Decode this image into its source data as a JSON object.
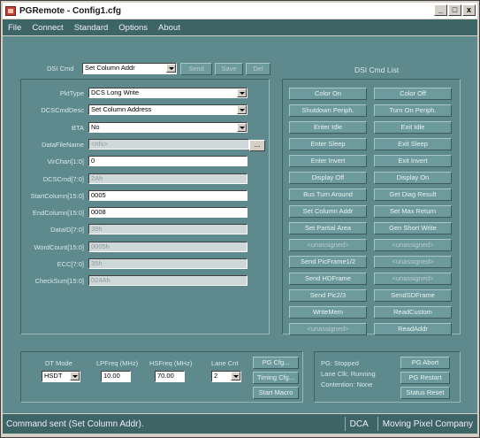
{
  "window": {
    "title": "PGRemote - Config1.cfg",
    "minimize": "_",
    "maximize": "□",
    "close": "x"
  },
  "menu": [
    "File",
    "Connect",
    "Standard",
    "Options",
    "About"
  ],
  "dsi_cmd": {
    "label": "DSI Cmd",
    "value": "Set Column Addr",
    "send": "Send",
    "save": "Save",
    "del": "Del"
  },
  "params": [
    {
      "label": "PktType",
      "value": "DCS Long Write",
      "kind": "dropdown"
    },
    {
      "label": "DCSCmdDesc",
      "value": "Set Column Address",
      "kind": "dropdown"
    },
    {
      "label": "BTA",
      "value": "No",
      "kind": "dropdown"
    },
    {
      "label": "DataFileName",
      "value": "<nfs>",
      "kind": "file"
    },
    {
      "label": "VirChan[1:0]",
      "value": "0",
      "kind": "text"
    },
    {
      "label": "DCSCmd[7:0]",
      "value": "2Ah",
      "kind": "disabled"
    },
    {
      "label": "StartColumn[15:0]",
      "value": "0005",
      "kind": "text"
    },
    {
      "label": "EndColumn[15:0]",
      "value": "0008",
      "kind": "text"
    },
    {
      "label": "DataID[7:0]",
      "value": "39h",
      "kind": "disabled"
    },
    {
      "label": "WordCount[15:0]",
      "value": "0005h",
      "kind": "disabled"
    },
    {
      "label": "ECC[7:0]",
      "value": "35h",
      "kind": "disabled"
    },
    {
      "label": "CheckSum[15:0]",
      "value": "024Ah",
      "kind": "disabled"
    }
  ],
  "file_browse": "...",
  "cmd_list": {
    "title": "DSI Cmd List",
    "buttons": [
      "Color On",
      "Color Off",
      "Shutdown Periph.",
      "Turn On Periph.",
      "Enter Idle",
      "Exit Idle",
      "Enter Sleep",
      "Exit Sleep",
      "Enter Invert",
      "Exit Invert",
      "Display Off",
      "Display On",
      "Bus Turn Around",
      "Get Diag Result",
      "Set Column Addr",
      "Set Max Return",
      "Set Partial Area",
      "Gen Short Write",
      "<unassigned>",
      "<unassigned>",
      "Send PicFrame1/2",
      "<unassigned>",
      "Send HDFrame",
      "<unassigned>",
      "Send Pic2/3",
      "SendSDFrame",
      "WriteMem",
      "ReadCustom",
      "<unassigned>",
      "ReadAddr"
    ]
  },
  "bottom": {
    "dt_mode_label": "DT Mode",
    "dt_mode_value": "HSDT",
    "lpfreq_label": "LPFreq (MHz)",
    "lpfreq_value": "10.00",
    "hsfreq_label": "HSFreq (MHz)",
    "hsfreq_value": "70.00",
    "lane_cnt_label": "Lane Cnt",
    "lane_cnt_value": "2",
    "pg_cfg": "PG Cfg...",
    "timing_cfg": "Timing Cfg...",
    "start_macro": "Start Macro",
    "status_lines": [
      "PG: Stopped",
      "Lane Clk: Running",
      "Contention: None"
    ],
    "pg_abort": "PG Abort",
    "pg_restart": "PG Restart",
    "status_reset": "Status Reset"
  },
  "status_bar": {
    "message": "Command sent (Set Column Addr).",
    "mode": "DCA",
    "company": "Moving Pixel Company"
  }
}
